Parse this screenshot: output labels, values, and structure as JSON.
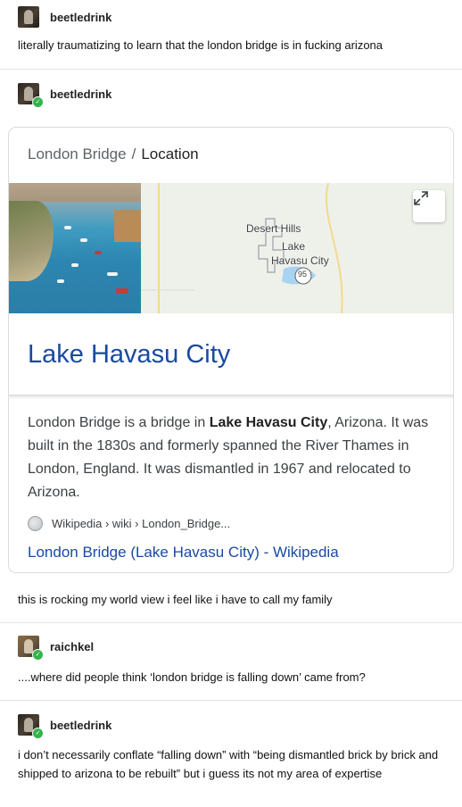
{
  "posts": [
    {
      "username": "beetledrink",
      "text": "literally traumatizing to learn that the london bridge is in fucking arizona"
    },
    {
      "username": "beetledrink",
      "text": "this is rocking my world view i feel like i have to call my family"
    },
    {
      "username": "raichkel",
      "text": "....where did people think ‘london bridge is falling down’ came from?"
    },
    {
      "username": "beetledrink",
      "text": "i don’t necessarily conflate “falling down” with “being dismantled brick by brick and shipped to arizona to be rebuilt” but i guess its not my area of expertise"
    }
  ],
  "google_card": {
    "breadcrumb_parent": "London Bridge",
    "breadcrumb_sep": "/",
    "breadcrumb_current": "Location",
    "map_labels": {
      "desert_hills": "Desert Hills",
      "lake": "Lake",
      "havasu_city": "Havasu City",
      "route": "95"
    },
    "place_title": "Lake Havasu City",
    "desc_1": "London Bridge is a bridge in ",
    "desc_bold": "Lake Havasu City",
    "desc_2": ", Arizona. It was built in the 1830s and formerly spanned the River Thames in London, England. It was dismantled in 1967 and relocated to Arizona.",
    "source_breadcrumb": "Wikipedia › wiki › London_Bridge...",
    "source_link": "London Bridge (Lake Havasu City) - Wikipedia"
  },
  "icons": {
    "avatar_badge": "tumblr-badge-icon",
    "expand": "expand-arrows-icon",
    "globe": "globe-icon"
  },
  "colors": {
    "link_blue": "#1a4aa0",
    "badge_green": "#35b34a",
    "divider": "#e4e4e4"
  }
}
